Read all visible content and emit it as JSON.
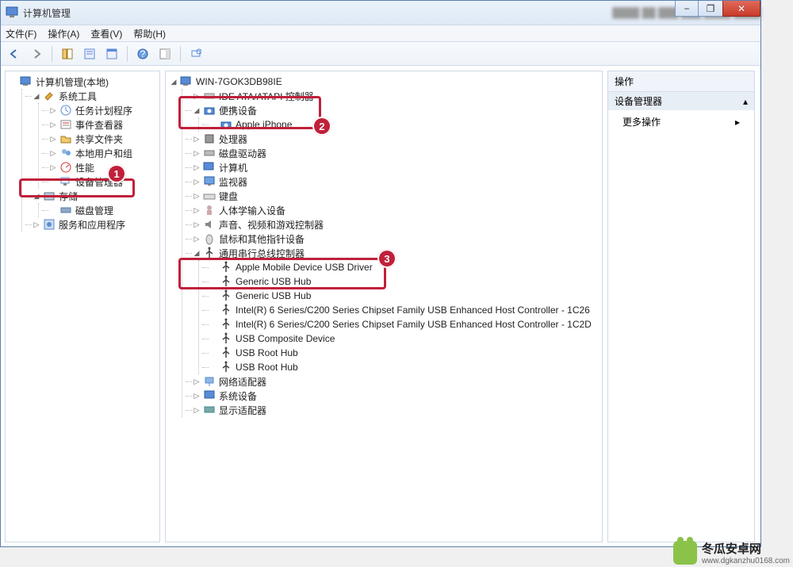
{
  "window": {
    "title": "计算机管理",
    "blur_text": "……",
    "min_tip": "−",
    "max_tip": "❐",
    "close_tip": "✕"
  },
  "menu": {
    "file": "文件(F)",
    "action": "操作(A)",
    "view": "查看(V)",
    "help": "帮助(H)"
  },
  "left_tree": {
    "root": "计算机管理(本地)",
    "sys_tools": "系统工具",
    "task_sched": "任务计划程序",
    "event_viewer": "事件查看器",
    "shared": "共享文件夹",
    "local_users": "本地用户和组",
    "perf": "性能",
    "dev_mgr": "设备管理器",
    "storage": "存储",
    "disk_mgmt": "磁盘管理",
    "services": "服务和应用程序"
  },
  "mid_tree": {
    "root": "WIN-7GOK3DB98IE",
    "ide": "IDE ATA/ATAPI 控制器",
    "portable": "便携设备",
    "iphone": "Apple iPhone",
    "cpu": "处理器",
    "disk_drv": "磁盘驱动器",
    "computer": "计算机",
    "monitor": "监视器",
    "keyboard": "键盘",
    "hid": "人体学输入设备",
    "sound": "声音、视频和游戏控制器",
    "mouse": "鼠标和其他指针设备",
    "usb_ctrl": "通用串行总线控制器",
    "usb_items": [
      "Apple Mobile Device USB Driver",
      "Generic USB Hub",
      "Generic USB Hub",
      "Intel(R) 6 Series/C200 Series Chipset Family USB Enhanced Host Controller - 1C26",
      "Intel(R) 6 Series/C200 Series Chipset Family USB Enhanced Host Controller - 1C2D",
      "USB Composite Device",
      "USB Root Hub",
      "USB Root Hub"
    ],
    "net": "网络适配器",
    "sys_dev": "系统设备",
    "display": "显示适配器"
  },
  "right": {
    "hdr": "操作",
    "cat": "设备管理器",
    "more": "更多操作"
  },
  "annotations": {
    "1": "1",
    "2": "2",
    "3": "3"
  },
  "watermark": {
    "line1": "冬瓜安卓网",
    "line2": "www.dgkanzhu0168.com"
  }
}
